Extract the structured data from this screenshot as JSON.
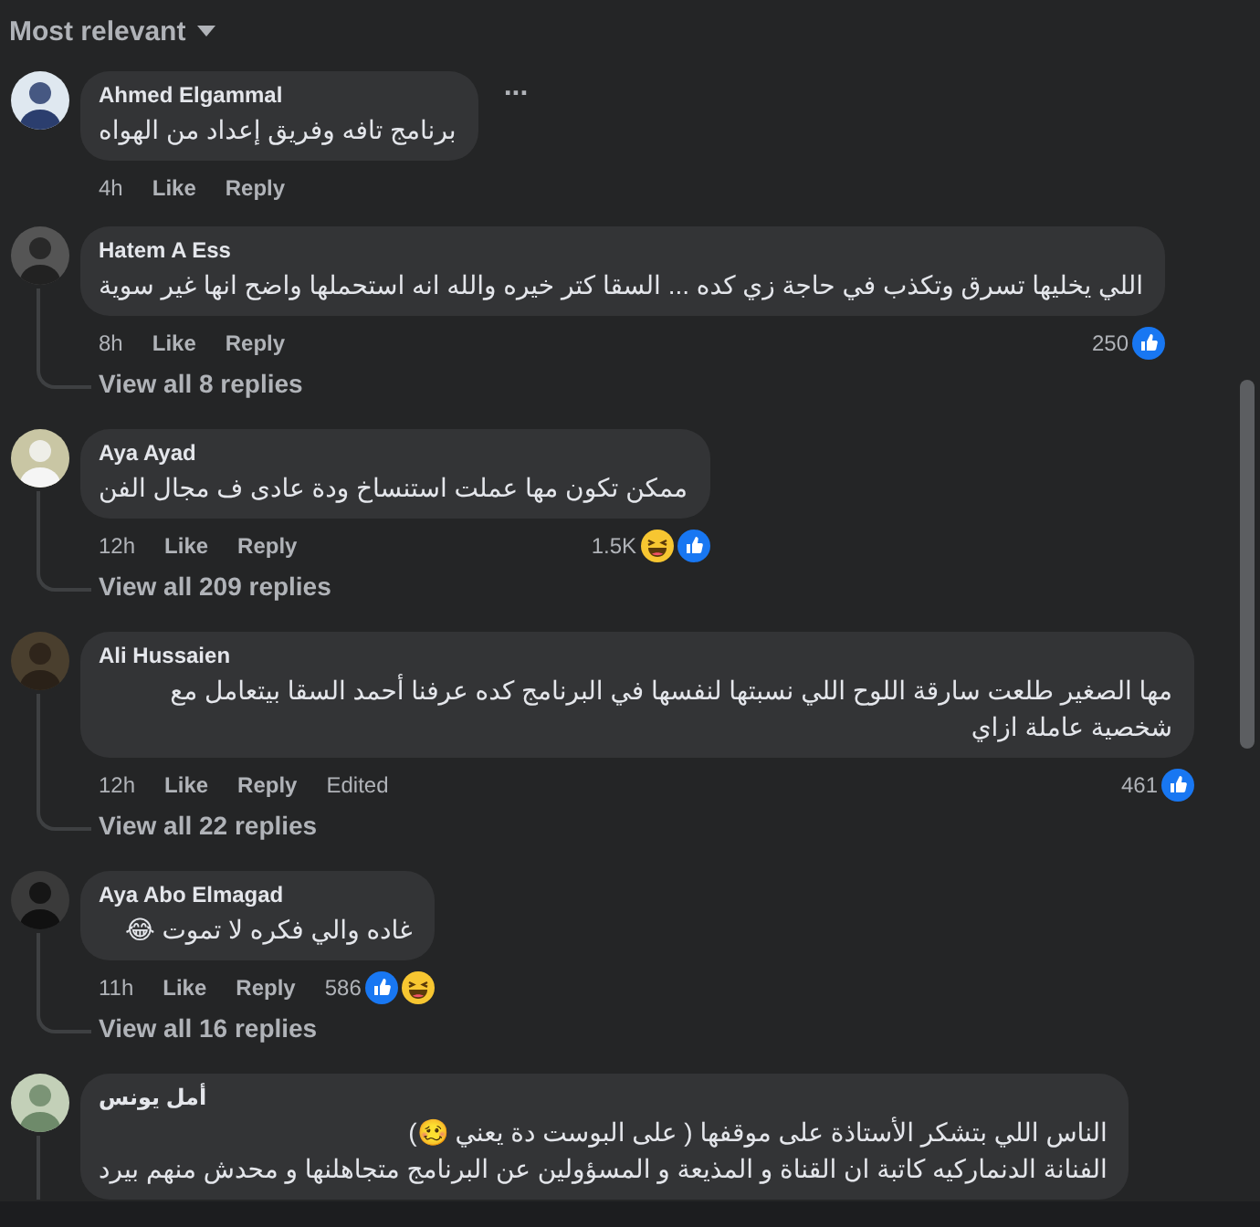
{
  "sort": {
    "label": "Most relevant"
  },
  "comments": [
    {
      "author": "Ahmed Elgammal",
      "text": [
        "برنامج تافه وفريق إعداد من الهواه"
      ],
      "time": "4h",
      "actions": [
        "Like",
        "Reply"
      ],
      "more": "..."
    },
    {
      "author": "Hatem A Ess",
      "text": [
        "اللي يخليها تسرق وتكذب في حاجة زي كده ... السقا كتر خيره والله انه استحملها واضح انها غير سوية"
      ],
      "time": "8h",
      "actions": [
        "Like",
        "Reply"
      ],
      "reactions": [
        {
          "kind": "like"
        }
      ],
      "count": "250",
      "replies": "View all 8 replies"
    },
    {
      "author": "Aya Ayad",
      "text": [
        "ممكن تكون مها عملت استنساخ ودة عادى ف مجال الفن"
      ],
      "time": "12h",
      "actions": [
        "Like",
        "Reply"
      ],
      "reactions": [
        {
          "kind": "haha"
        },
        {
          "kind": "like"
        }
      ],
      "count": "1.5K",
      "replies": "View all 209 replies"
    },
    {
      "author": "Ali Hussaien",
      "text": [
        "مها الصغير طلعت سارقة اللوح اللي نسبتها لنفسها في البرنامج كده عرفنا أحمد السقا بيتعامل مع شخصية عاملة ازاي"
      ],
      "time": "12h",
      "actions": [
        "Like",
        "Reply",
        "Edited"
      ],
      "reactions": [
        {
          "kind": "like"
        }
      ],
      "count": "461",
      "replies": "View all 22 replies"
    },
    {
      "author": "Aya Abo Elmagad",
      "text": [
        "غاده والي فكره لا تموت 😂"
      ],
      "time": "11h",
      "actions": [
        "Like",
        "Reply"
      ],
      "reactions": [
        {
          "kind": "like"
        },
        {
          "kind": "haha"
        }
      ],
      "count": "586",
      "replies": "View all 16 replies"
    },
    {
      "author": "أمل يونس",
      "text": [
        "الناس اللي بتشكر الأستاذة على موقفها ( على البوست دة يعني 🥴)",
        "الفنانة الدنماركيه كاتبة ان القناة و المذيعة و المسؤولين عن البرنامج متجاهلنها و محدش منهم بيرد"
      ],
      "pinned_line": true
    }
  ]
}
